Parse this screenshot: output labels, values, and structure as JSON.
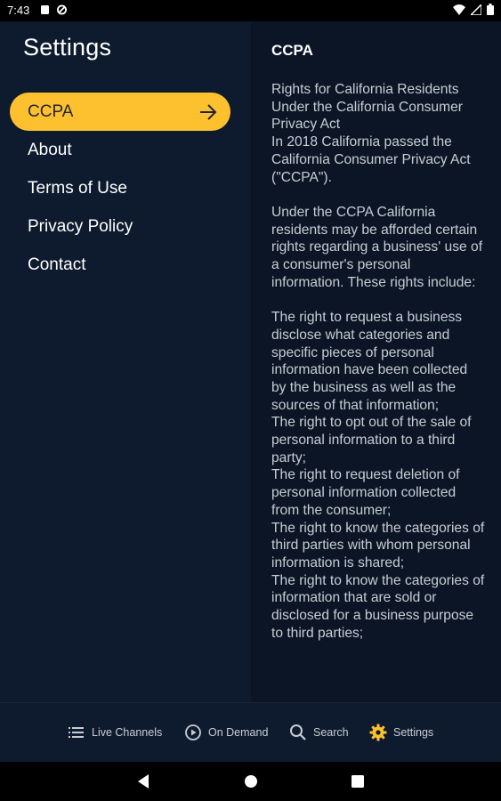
{
  "status_bar": {
    "time": "7:43"
  },
  "left_panel": {
    "title": "Settings",
    "items": [
      {
        "label": "CCPA",
        "active": true
      },
      {
        "label": "About"
      },
      {
        "label": "Terms of Use"
      },
      {
        "label": "Privacy Policy"
      },
      {
        "label": "Contact"
      }
    ]
  },
  "detail": {
    "title": "CCPA",
    "body": "Rights for California Residents Under the California Consumer Privacy Act\nIn 2018 California passed the California Consumer Privacy Act (\"CCPA\").\n\nUnder the CCPA California residents may be afforded certain rights regarding a business' use of a consumer's personal information. These rights include:\n\nThe right to request a business disclose what categories and specific pieces of personal information have been collected by the business as well as the sources of that information;\nThe right to opt out of the sale of personal information to a third party;\nThe right to request deletion of personal information collected from the consumer;\nThe right to know the categories of third parties with whom personal information is shared;\nThe right to know the categories of information that are sold or disclosed for a business purpose to third parties;"
  },
  "tab_bar": {
    "tabs": [
      {
        "label": "Live Channels",
        "icon": "list-icon"
      },
      {
        "label": "On Demand",
        "icon": "play-circle-icon"
      },
      {
        "label": "Search",
        "icon": "search-icon"
      },
      {
        "label": "Settings",
        "icon": "gear-icon",
        "active": true
      }
    ]
  },
  "colors": {
    "accent": "#fdc12f",
    "background": "#0b1526",
    "panel": "#0e1b2e"
  }
}
